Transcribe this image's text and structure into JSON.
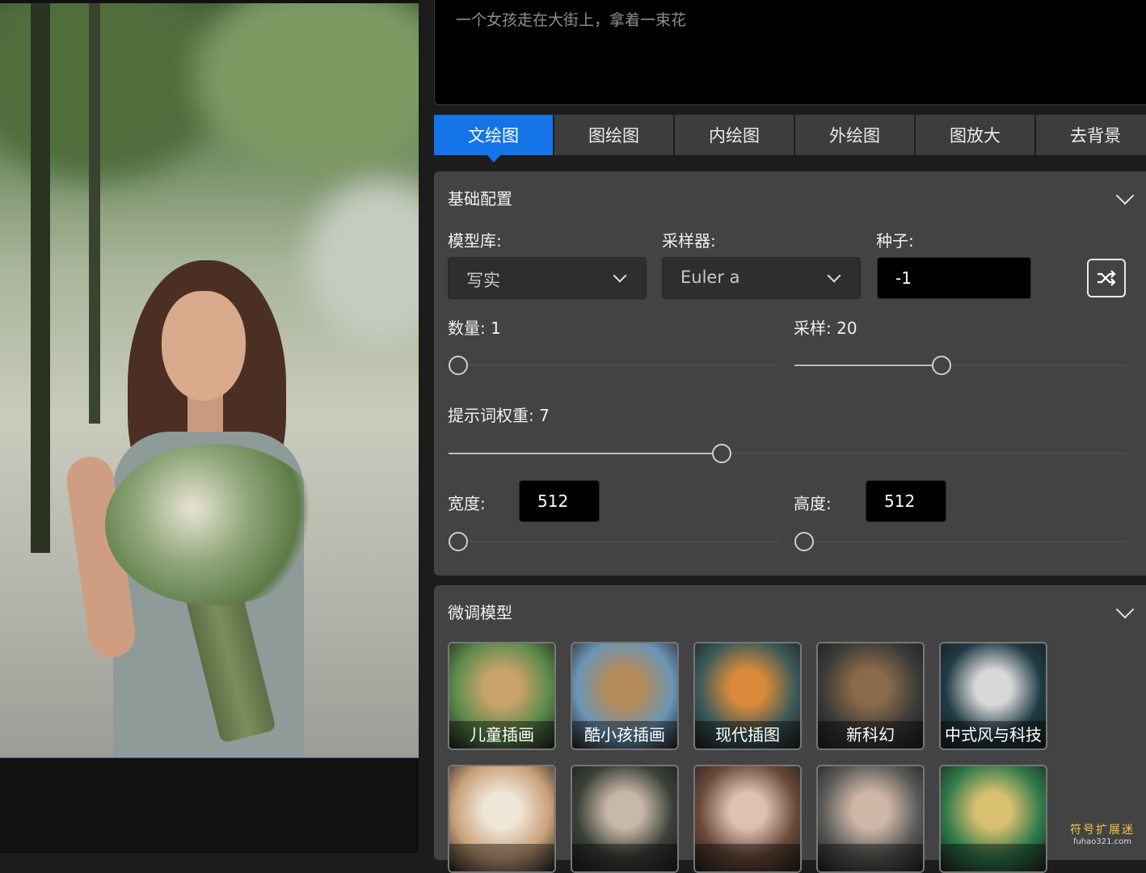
{
  "prompt": {
    "text": "一个女孩走在大街上，拿着一束花"
  },
  "tabs": [
    {
      "label": "文绘图",
      "active": true
    },
    {
      "label": "图绘图",
      "active": false
    },
    {
      "label": "内绘图",
      "active": false
    },
    {
      "label": "外绘图",
      "active": false
    },
    {
      "label": "图放大",
      "active": false
    },
    {
      "label": "去背景",
      "active": false
    }
  ],
  "basic": {
    "title": "基础配置",
    "model_label": "模型库:",
    "model_value": "写实",
    "sampler_label": "采样器:",
    "sampler_value": "Euler a",
    "seed_label": "种子:",
    "seed_value": "-1",
    "count_label": "数量: 1",
    "count_value": 1,
    "steps_label": "采样: 20",
    "steps_value": 20,
    "cfg_label": "提示词权重: 7",
    "cfg_value": 7,
    "width_label": "宽度:",
    "width_value": "512",
    "height_label": "高度:",
    "height_value": "512",
    "count_fraction": 0.0,
    "steps_fraction": 0.44,
    "cfg_fraction": 0.4,
    "width_fraction": 0.0,
    "height_fraction": 0.0
  },
  "finetune": {
    "title": "微调模型",
    "models": [
      {
        "label": "儿童插画",
        "colors": [
          "#5a8a4c",
          "#c9a36a"
        ]
      },
      {
        "label": "酷小孩插画",
        "colors": [
          "#6a95b5",
          "#b58a5a"
        ]
      },
      {
        "label": "现代插图",
        "colors": [
          "#3b5a5a",
          "#d98a3a"
        ]
      },
      {
        "label": "新科幻",
        "colors": [
          "#3a3a38",
          "#8a6a4a"
        ]
      },
      {
        "label": "中式风与科技",
        "colors": [
          "#1f3a44",
          "#d8d8d8"
        ]
      },
      {
        "label": "",
        "colors": [
          "#c9a07a",
          "#f0e6d8"
        ]
      },
      {
        "label": "",
        "colors": [
          "#3a4038",
          "#c8b8a8"
        ]
      },
      {
        "label": "",
        "colors": [
          "#6a4a3a",
          "#e0c0b0"
        ]
      },
      {
        "label": "",
        "colors": [
          "#5a5a58",
          "#d0b8a8"
        ]
      },
      {
        "label": "",
        "colors": [
          "#2f7a4a",
          "#d8c070"
        ]
      }
    ]
  },
  "watermark": {
    "cn": "符号扩展迷",
    "en": "fuhao321.com"
  },
  "colors": {
    "accent": "#1473e6",
    "panel": "#434343",
    "background": "#1c1c1c"
  }
}
